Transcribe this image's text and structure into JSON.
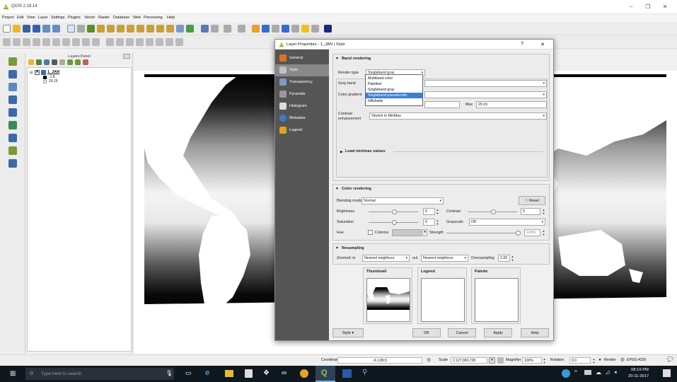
{
  "app": {
    "title": "QGIS 2.18.14",
    "window_controls": {
      "minimize": "–",
      "restore": "❐",
      "close": "✕"
    }
  },
  "menu": [
    "Project",
    "Edit",
    "View",
    "Layer",
    "Settings",
    "Plugins",
    "Vector",
    "Raster",
    "Database",
    "Web",
    "Processing",
    "Help"
  ],
  "layers_panel": {
    "title": "Layers Panel",
    "layer": {
      "name": "1_JAN",
      "min": "-1.8",
      "max": "29.19"
    }
  },
  "dialog": {
    "title": "Layer Properties - 1_JAN | Style",
    "help": "?",
    "close": "✕",
    "sidebar": [
      "General",
      "Style",
      "Transparency",
      "Pyramids",
      "Histogram",
      "Metadata",
      "Legend"
    ],
    "selected_tab": "Style",
    "band_rendering": {
      "title": "Band rendering",
      "render_type_label": "Render type",
      "render_type_value": "Singleband gray",
      "gray_band_label": "Gray band",
      "color_gradient_label": "Color gradient",
      "max_label": "Max",
      "max_value": "29.19",
      "contrast_label_1": "Contrast",
      "contrast_label_2": "enhancement",
      "contrast_value": "Stretch to MinMax",
      "load_minmax": "Load min/max values",
      "render_type_options": [
        "Multiband color",
        "Paletted",
        "Singleband gray",
        "Singleband pseudocolor",
        "Hillshade"
      ],
      "highlighted_option": "Singleband pseudocolor"
    },
    "color_rendering": {
      "title": "Color rendering",
      "blending_label": "Blending mode",
      "blending_value": "Normal",
      "reset": "Reset",
      "brightness_label": "Brightness",
      "brightness_value": "0",
      "contrast_label": "Contrast",
      "contrast_value": "0",
      "saturation_label": "Saturation",
      "saturation_value": "0",
      "grayscale_label": "Grayscale",
      "grayscale_value": "Off",
      "hue_label": "Hue",
      "colorize_label": "Colorize",
      "strength_label": "Strength",
      "strength_value": "100%"
    },
    "resampling": {
      "title": "Resampling",
      "zoomed_in_label": "Zoomed: in",
      "zoomed_in_value": "Nearest neighbour",
      "out_label": "out",
      "out_value": "Nearest neighbour",
      "oversampling_label": "Oversampling",
      "oversampling_value": "2.00"
    },
    "previews": {
      "thumbnail": "Thumbnail",
      "legend": "Legend",
      "palette": "Palette"
    },
    "buttons": {
      "style": "Style",
      "ok": "OK",
      "cancel": "Cancel",
      "apply": "Apply",
      "help": "Help"
    }
  },
  "status_bar": {
    "coordinate_label": "Coordinate",
    "coordinate_value": "-6.1,89.5",
    "scale_label": "Scale",
    "scale_value": "1:127,000,728",
    "magnifier_label": "Magnifier",
    "magnifier_value": "100%",
    "rotation_label": "Rotation",
    "rotation_value": "0.0",
    "render_label": "Render",
    "crs": "EPSG:4326"
  },
  "taskbar": {
    "search_placeholder": "Type here to search",
    "time": "08:19 PM",
    "date": "20-11-2017"
  }
}
